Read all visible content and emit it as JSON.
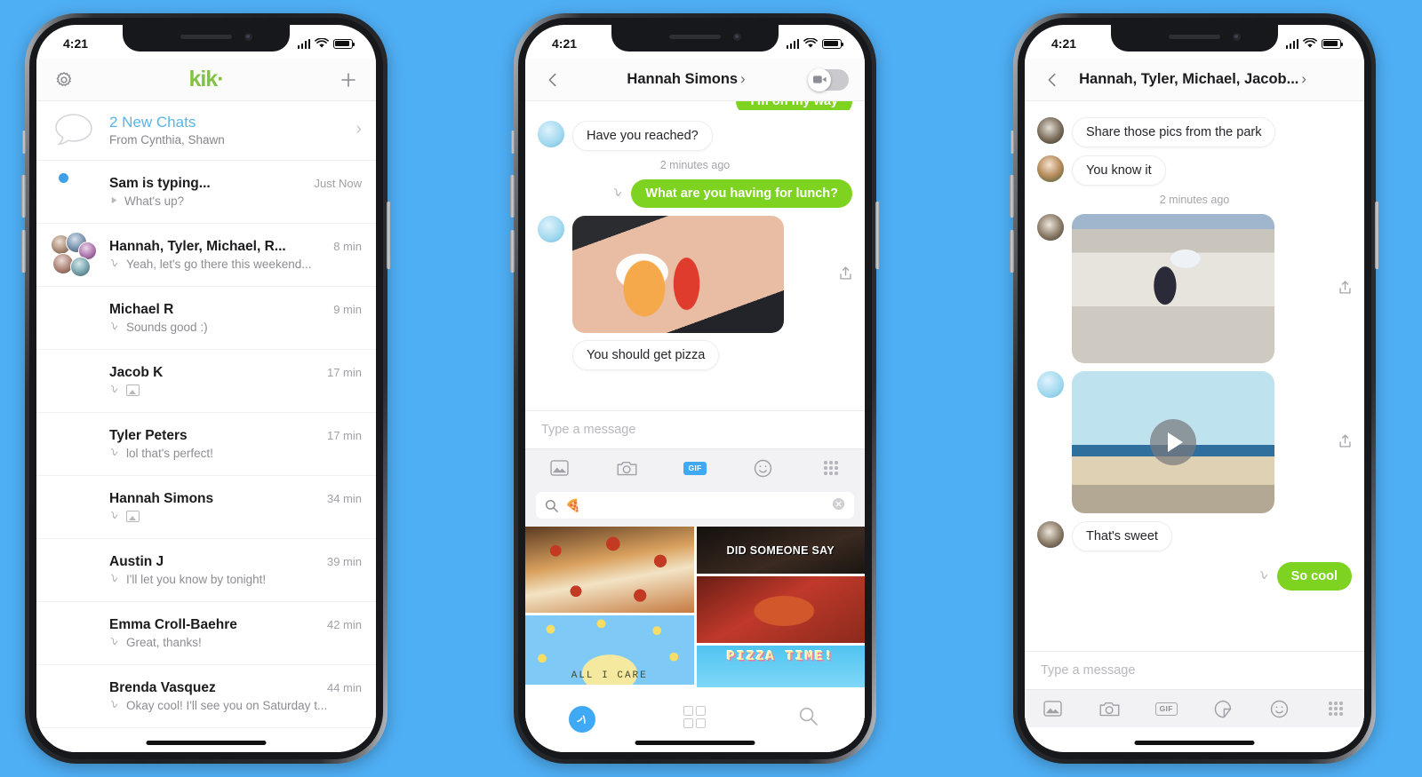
{
  "background_color": "#4FAFF5",
  "brand": {
    "name": "kik·",
    "green": "#7ED321",
    "blue": "#3FA9F5"
  },
  "status_bar": {
    "time": "4:21",
    "signal_icon": "cellular-bars-icon",
    "wifi_icon": "wifi-icon",
    "battery_icon": "battery-icon"
  },
  "phone1": {
    "header": {
      "settings_icon": "gear-icon",
      "logo": "kik·",
      "add_icon": "plus-icon"
    },
    "new_chats": {
      "icon": "chat-bubble-icon",
      "title": "2 New Chats",
      "subtitle": "From Cynthia, Shawn",
      "chevron": "›"
    },
    "chats": [
      {
        "name": "Sam is typing...",
        "time": "Just Now",
        "preview": "What's up?",
        "receipt": "typing-icon",
        "unread": true,
        "avatar_hue": 95
      },
      {
        "name": "Hannah, Tyler, Michael, R...",
        "time": "8 min",
        "preview": "Yeah, let's go there this weekend...",
        "receipt": "read-icon",
        "unread": false,
        "group": true
      },
      {
        "name": "Michael R",
        "time": "9 min",
        "preview": "Sounds good :)",
        "receipt": "read-icon",
        "unread": false,
        "avatar_hue": 20
      },
      {
        "name": "Jacob K",
        "time": "17 min",
        "preview": "",
        "receipt": "read-icon",
        "attachment": "image-icon",
        "unread": false,
        "avatar_hue": 210
      },
      {
        "name": "Tyler Peters",
        "time": "17 min",
        "preview": "lol that's perfect!",
        "receipt": "read-icon",
        "unread": false,
        "avatar_hue": 280
      },
      {
        "name": "Hannah Simons",
        "time": "34 min",
        "preview": "",
        "receipt": "read-icon",
        "attachment": "photo-icon",
        "unread": false,
        "avatar_hue": 60
      },
      {
        "name": "Austin J",
        "time": "39 min",
        "preview": "I'll let you know by tonight!",
        "receipt": "read-icon",
        "unread": false,
        "avatar_hue": 175
      },
      {
        "name": "Emma Croll-Baehre",
        "time": "42 min",
        "preview": "Great, thanks!",
        "receipt": "read-icon",
        "unread": false,
        "avatar_hue": 200
      },
      {
        "name": "Brenda Vasquez",
        "time": "44 min",
        "preview": "Okay cool! I'll see you on Saturday t...",
        "receipt": "read-icon",
        "unread": false,
        "avatar_hue": 120
      }
    ]
  },
  "phone2": {
    "header": {
      "back_icon": "back-arrow-icon",
      "title": "Hannah Simons",
      "chevron": "›",
      "toggle_icon": "video-camera-icon",
      "toggle_on": false
    },
    "messages": [
      {
        "side": "out",
        "text": "I'm on my way",
        "clipped": true
      },
      {
        "side": "in",
        "text": "Have you reached?"
      },
      {
        "type": "timestamp",
        "text": "2 minutes ago"
      },
      {
        "side": "out",
        "text": "What are you having for lunch?",
        "receipt": "read-icon"
      },
      {
        "side": "in",
        "type": "image",
        "caption": "You should get pizza",
        "share_icon": "share-icon"
      }
    ],
    "composer": {
      "placeholder": "Type a message"
    },
    "tools": [
      {
        "icon": "gallery-icon",
        "active": false
      },
      {
        "icon": "camera-icon",
        "active": false
      },
      {
        "icon": "gif-icon",
        "label": "GIF",
        "active": true
      },
      {
        "icon": "smiley-icon",
        "active": false
      },
      {
        "icon": "keypad-icon",
        "active": false
      }
    ],
    "gif_search": {
      "search_icon": "search-icon",
      "value": "🍕",
      "clear_icon": "clear-icon"
    },
    "gif_results": [
      {
        "label": "",
        "kind": "pizza-cheese-pull"
      },
      {
        "label": "DID SOMEONE SAY",
        "kind": "did-someone-say"
      },
      {
        "label": "",
        "kind": "pizza-hands"
      },
      {
        "label": "ALL I CARE",
        "kind": "all-i-care"
      },
      {
        "label": "PIZZA TIME!",
        "kind": "pizza-time"
      }
    ],
    "tabbar": [
      {
        "icon": "send-icon",
        "active": true
      },
      {
        "icon": "apps-grid-icon",
        "active": false
      },
      {
        "icon": "search-icon",
        "active": false
      }
    ]
  },
  "phone3": {
    "header": {
      "back_icon": "back-arrow-icon",
      "title": "Hannah, Tyler, Michael, Jacob...",
      "chevron": "›"
    },
    "messages": [
      {
        "side": "in",
        "text": "Share those pics from the park"
      },
      {
        "side": "in",
        "text": "You know it"
      },
      {
        "type": "timestamp",
        "text": "2 minutes ago"
      },
      {
        "side": "in",
        "type": "image",
        "subject": "skateboarder-in-bowl",
        "share_icon": "share-icon"
      },
      {
        "side": "in",
        "type": "video",
        "subject": "skateboarder-at-beach",
        "play_icon": "play-icon",
        "share_icon": "share-icon"
      },
      {
        "side": "in",
        "text": "That's sweet"
      },
      {
        "side": "out",
        "text": "So cool",
        "receipt": "read-icon"
      }
    ],
    "composer": {
      "placeholder": "Type a message"
    },
    "tools": [
      {
        "icon": "gallery-icon",
        "active": false
      },
      {
        "icon": "camera-icon",
        "active": false
      },
      {
        "icon": "gif-icon",
        "label": "GIF",
        "active": false
      },
      {
        "icon": "sticker-icon",
        "active": false
      },
      {
        "icon": "smiley-icon",
        "active": false
      },
      {
        "icon": "keypad-icon",
        "active": false
      }
    ]
  }
}
